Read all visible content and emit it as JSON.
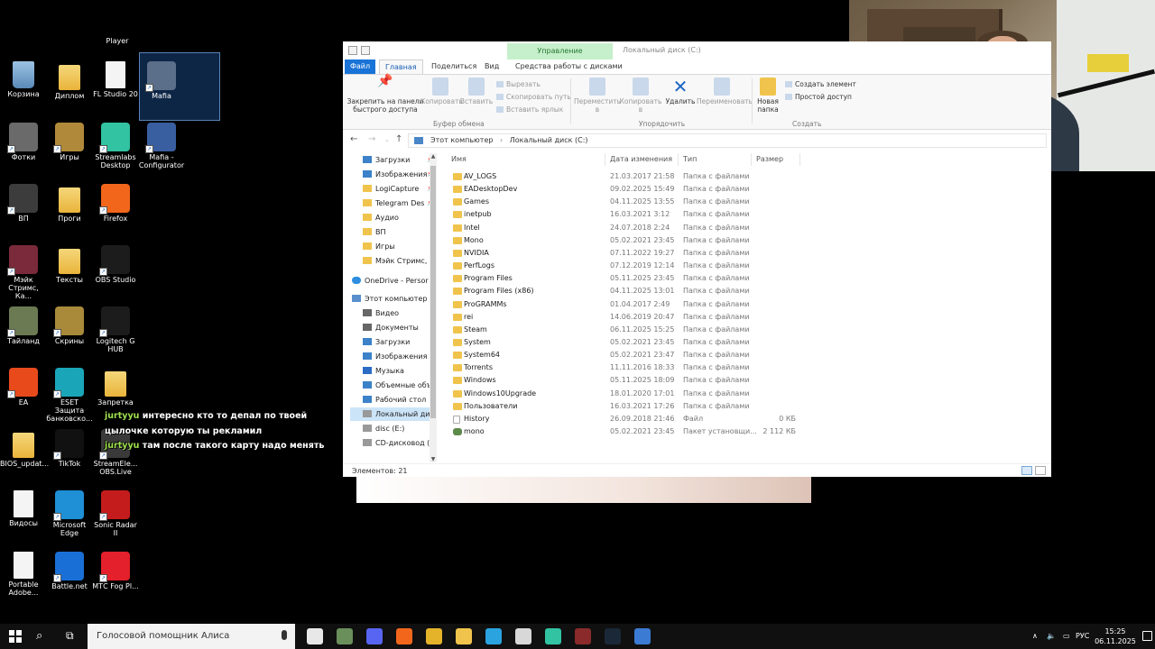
{
  "desktop": {
    "player_label": "Player",
    "icons": [
      {
        "label": "Корзина",
        "icon": "recycle-bin-icon",
        "col": 0,
        "row": 0,
        "kind": "recycle"
      },
      {
        "label": "Диплом",
        "icon": "folder-icon",
        "col": 1,
        "row": 0,
        "kind": "folder"
      },
      {
        "label": "FL Studio 20",
        "icon": "fl-studio-icon",
        "col": 2,
        "row": 0,
        "kind": "file"
      },
      {
        "label": "Mafia",
        "icon": "mafia-icon",
        "col": 3,
        "row": 0,
        "kind": "app",
        "color": "#5b6e8a"
      },
      {
        "label": "Фотки",
        "icon": "folder-icon",
        "col": 0,
        "row": 1,
        "kind": "app",
        "color": "#6a6a6a"
      },
      {
        "label": "Игры",
        "icon": "folder-icon",
        "col": 1,
        "row": 1,
        "kind": "app",
        "color": "#b08a3a"
      },
      {
        "label": "Streamlabs Desktop",
        "icon": "streamlabs-icon",
        "col": 2,
        "row": 1,
        "kind": "app",
        "color": "#31c3a2"
      },
      {
        "label": "Mafia - Configurator",
        "icon": "mafia-configurator-icon",
        "col": 3,
        "row": 1,
        "kind": "app",
        "color": "#3a5fa0"
      },
      {
        "label": "ВП",
        "icon": "folder-icon",
        "col": 0,
        "row": 2,
        "kind": "app",
        "color": "#3c3c3c"
      },
      {
        "label": "Проги",
        "icon": "folder-icon",
        "col": 1,
        "row": 2,
        "kind": "folder"
      },
      {
        "label": "Firefox",
        "icon": "firefox-icon",
        "col": 2,
        "row": 2,
        "kind": "app",
        "color": "#f2661c"
      },
      {
        "label": "Мэйк Стримс, Ка...",
        "icon": "folder-icon",
        "col": 0,
        "row": 3,
        "kind": "app",
        "color": "#7a2a3a"
      },
      {
        "label": "Тексты",
        "icon": "folder-icon",
        "col": 1,
        "row": 3,
        "kind": "folder"
      },
      {
        "label": "OBS Studio",
        "icon": "obs-icon",
        "col": 2,
        "row": 3,
        "kind": "app",
        "color": "#1c1c1c"
      },
      {
        "label": "Тайланд",
        "icon": "folder-icon",
        "col": 0,
        "row": 4,
        "kind": "app",
        "color": "#6b7a52"
      },
      {
        "label": "Скрины",
        "icon": "folder-icon",
        "col": 1,
        "row": 4,
        "kind": "app",
        "color": "#a88a3a"
      },
      {
        "label": "Logitech G HUB",
        "icon": "logitech-icon",
        "col": 2,
        "row": 4,
        "kind": "app",
        "color": "#1c1c1c"
      },
      {
        "label": "EA",
        "icon": "ea-icon",
        "col": 0,
        "row": 5,
        "kind": "app",
        "color": "#e84a1c"
      },
      {
        "label": "ESET Защита банковско...",
        "icon": "eset-icon",
        "col": 1,
        "row": 5,
        "kind": "app",
        "color": "#1aa6b8"
      },
      {
        "label": "Запретка",
        "icon": "folder-icon",
        "col": 2,
        "row": 5,
        "kind": "folder"
      },
      {
        "label": "BIOS_updat...",
        "icon": "folder-icon",
        "col": 0,
        "row": 6,
        "kind": "folder"
      },
      {
        "label": "TikTok",
        "icon": "tiktok-icon",
        "col": 1,
        "row": 6,
        "kind": "app",
        "color": "#111111"
      },
      {
        "label": "StreamEle... OBS.Live",
        "icon": "streamelements-icon",
        "col": 2,
        "row": 6,
        "kind": "app",
        "color": "#3a3a3a"
      },
      {
        "label": "Видосы",
        "icon": "file-icon",
        "col": 0,
        "row": 7,
        "kind": "file"
      },
      {
        "label": "Microsoft Edge",
        "icon": "edge-icon",
        "col": 1,
        "row": 7,
        "kind": "app",
        "color": "#1f8fd6"
      },
      {
        "label": "Sonic Radar II",
        "icon": "sonic-radar-icon",
        "col": 2,
        "row": 7,
        "kind": "app",
        "color": "#c41c1c"
      },
      {
        "label": "Portable Adobe...",
        "icon": "file-icon",
        "col": 0,
        "row": 8,
        "kind": "file"
      },
      {
        "label": "Battle.net",
        "icon": "battlenet-icon",
        "col": 1,
        "row": 8,
        "kind": "app",
        "color": "#1a6fd6"
      },
      {
        "label": "МТС Fog Pl...",
        "icon": "mts-fog-icon",
        "col": 2,
        "row": 8,
        "kind": "app",
        "color": "#e3202b"
      }
    ]
  },
  "chat": [
    {
      "user": "jurtyyu",
      "text": "интересно кто то депал по твоей цылочке которую ты рекламил"
    },
    {
      "user": "jurtyyu",
      "text": "там после такого карту надо менять"
    }
  ],
  "explorer": {
    "context_tab": "Управление",
    "window_title": "Локальный диск (C:)",
    "tabs": [
      "Файл",
      "Главная",
      "Поделиться",
      "Вид",
      "Средства работы с дисками"
    ],
    "ribbon": {
      "pin": "Закрепить на панели быстрого доступа",
      "copy": "Копировать",
      "paste": "Вставить",
      "cut": "Вырезать",
      "copy_path": "Скопировать путь",
      "paste_shortcut": "Вставить ярлык",
      "move": "Переместить в",
      "copy_to": "Копировать в",
      "delete": "Удалить",
      "rename": "Переименовать",
      "new_folder": "Новая папка",
      "new_item": "Создать элемент",
      "easy_access": "Простой доступ",
      "group_clipboard": "Буфер обмена",
      "group_organize": "Упорядочить",
      "group_new": "Создать"
    },
    "breadcrumb": [
      "Этот компьютер",
      "Локальный диск (C:)"
    ],
    "nav": [
      {
        "label": "Загрузки",
        "kind": "blue",
        "pin": true
      },
      {
        "label": "Изображения",
        "kind": "blue",
        "pin": true
      },
      {
        "label": "LogiCapture",
        "kind": "folder",
        "pin": true
      },
      {
        "label": "Telegram Des",
        "kind": "folder",
        "pin": true
      },
      {
        "label": "Аудио",
        "kind": "folder",
        "pin": false
      },
      {
        "label": "ВП",
        "kind": "folder",
        "pin": false
      },
      {
        "label": "Игры",
        "kind": "folder",
        "pin": false
      },
      {
        "label": "Мэйк Стримс, К",
        "kind": "folder",
        "pin": false
      },
      {
        "label": "OneDrive - Persor",
        "kind": "cloud",
        "pin": false
      },
      {
        "label": "Этот компьютер",
        "kind": "pc",
        "pin": false
      },
      {
        "label": "Видео",
        "kind": "dark",
        "pin": false
      },
      {
        "label": "Документы",
        "kind": "dark",
        "pin": false
      },
      {
        "label": "Загрузки",
        "kind": "blue",
        "pin": false
      },
      {
        "label": "Изображения",
        "kind": "blue",
        "pin": false
      },
      {
        "label": "Музыка",
        "kind": "music",
        "pin": false
      },
      {
        "label": "Объемные объ",
        "kind": "blue",
        "pin": false
      },
      {
        "label": "Рабочий стол",
        "kind": "blue",
        "pin": false
      },
      {
        "label": "Локальный дис",
        "kind": "drive",
        "pin": false,
        "selected": true
      },
      {
        "label": "disc (E:)",
        "kind": "drive",
        "pin": false
      },
      {
        "label": "CD-дисковод (F",
        "kind": "drive",
        "pin": false
      }
    ],
    "columns": [
      "Имя",
      "Дата изменения",
      "Тип",
      "Размер"
    ],
    "files": [
      {
        "name": "AV_LOGS",
        "date": "21.03.2017 21:58",
        "type": "Папка с файлами",
        "size": "",
        "kind": "folder"
      },
      {
        "name": "EADesktopDev",
        "date": "09.02.2025 15:49",
        "type": "Папка с файлами",
        "size": "",
        "kind": "folder"
      },
      {
        "name": "Games",
        "date": "04.11.2025 13:55",
        "type": "Папка с файлами",
        "size": "",
        "kind": "folder"
      },
      {
        "name": "inetpub",
        "date": "16.03.2021 3:12",
        "type": "Папка с файлами",
        "size": "",
        "kind": "folder"
      },
      {
        "name": "Intel",
        "date": "24.07.2018 2:24",
        "type": "Папка с файлами",
        "size": "",
        "kind": "folder"
      },
      {
        "name": "Mono",
        "date": "05.02.2021 23:45",
        "type": "Папка с файлами",
        "size": "",
        "kind": "folder"
      },
      {
        "name": "NVIDIA",
        "date": "07.11.2022 19:27",
        "type": "Папка с файлами",
        "size": "",
        "kind": "folder"
      },
      {
        "name": "PerfLogs",
        "date": "07.12.2019 12:14",
        "type": "Папка с файлами",
        "size": "",
        "kind": "folder"
      },
      {
        "name": "Program Files",
        "date": "05.11.2025 23:45",
        "type": "Папка с файлами",
        "size": "",
        "kind": "folder"
      },
      {
        "name": "Program Files (x86)",
        "date": "04.11.2025 13:01",
        "type": "Папка с файлами",
        "size": "",
        "kind": "folder"
      },
      {
        "name": "ProGRAMMs",
        "date": "01.04.2017 2:49",
        "type": "Папка с файлами",
        "size": "",
        "kind": "folder"
      },
      {
        "name": "rei",
        "date": "14.06.2019 20:47",
        "type": "Папка с файлами",
        "size": "",
        "kind": "folder"
      },
      {
        "name": "Steam",
        "date": "06.11.2025 15:25",
        "type": "Папка с файлами",
        "size": "",
        "kind": "folder"
      },
      {
        "name": "System",
        "date": "05.02.2021 23:45",
        "type": "Папка с файлами",
        "size": "",
        "kind": "folder"
      },
      {
        "name": "System64",
        "date": "05.02.2021 23:47",
        "type": "Папка с файлами",
        "size": "",
        "kind": "folder"
      },
      {
        "name": "Torrents",
        "date": "11.11.2016 18:33",
        "type": "Папка с файлами",
        "size": "",
        "kind": "folder"
      },
      {
        "name": "Windows",
        "date": "05.11.2025 18:09",
        "type": "Папка с файлами",
        "size": "",
        "kind": "folder"
      },
      {
        "name": "Windows10Upgrade",
        "date": "18.01.2020 17:01",
        "type": "Папка с файлами",
        "size": "",
        "kind": "folder"
      },
      {
        "name": "Пользователи",
        "date": "16.03.2021 17:26",
        "type": "Папка с файлами",
        "size": "",
        "kind": "folder"
      },
      {
        "name": "History",
        "date": "26.09.2018 21:46",
        "type": "Файл",
        "size": "0 КБ",
        "kind": "doc"
      },
      {
        "name": "mono",
        "date": "05.02.2021 23:45",
        "type": "Пакет установщи...",
        "size": "2 112 КБ",
        "kind": "pkg"
      }
    ],
    "status": "Элементов: 21"
  },
  "taskbar": {
    "search_placeholder": "Голосовой помощник Алиса",
    "apps": [
      {
        "icon": "yandex-icon",
        "color": "#e8e8e8"
      },
      {
        "icon": "browser-icon",
        "color": "#6a8f5a"
      },
      {
        "icon": "discord-icon",
        "color": "#5865f2"
      },
      {
        "icon": "firefox-icon",
        "color": "#f2661c"
      },
      {
        "icon": "chrome-icon",
        "color": "#e4b32a"
      },
      {
        "icon": "explorer-icon",
        "color": "#f0c44c"
      },
      {
        "icon": "telegram-icon",
        "color": "#2aa3df"
      },
      {
        "icon": "notepad-icon",
        "color": "#d8d8d8"
      },
      {
        "icon": "streamlabs-icon",
        "color": "#31c3a2"
      },
      {
        "icon": "mafia-icon",
        "color": "#8a2a2a"
      },
      {
        "icon": "steam-icon",
        "color": "#1b2838"
      },
      {
        "icon": "app-icon",
        "color": "#3b7bd4"
      }
    ],
    "lang": "РУС",
    "time": "15:25",
    "date": "06.11.2025"
  }
}
